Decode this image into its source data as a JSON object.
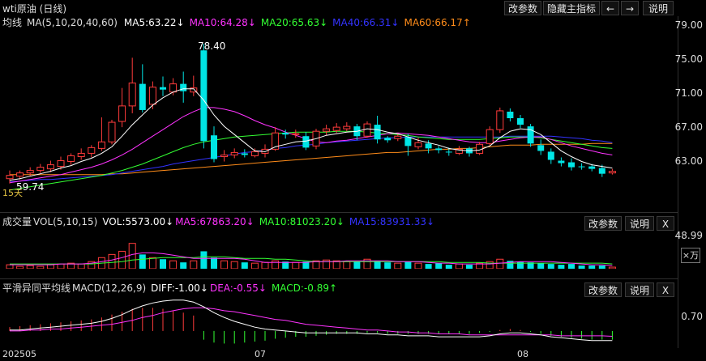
{
  "title": "wti原油 (日线)",
  "toolbar": {
    "params": "改参数",
    "hide_main": "隐藏主指标",
    "left_arrow": "←",
    "right_arrow": "→",
    "help": "说明"
  },
  "ma_panel": {
    "label": "均线",
    "params": "MA(5,10,20,40,60)",
    "ma5": "MA5:63.22↓",
    "ma10": "MA10:64.28↓",
    "ma20": "MA20:65.63↓",
    "ma40": "MA40:66.31↓",
    "ma60": "MA60:66.17↑",
    "high_label": "78.40",
    "low_label": "59.74",
    "corner_label": "15天",
    "axis": [
      "79.00",
      "75.00",
      "71.00",
      "67.00",
      "63.00"
    ]
  },
  "vol_panel": {
    "label": "成交量",
    "params": "VOL(5,10,15)",
    "vol": "VOL:5573.00↓",
    "ma5": "MA5:67863.20↓",
    "ma10": "MA10:81023.20↓",
    "ma15": "MA15:83931.33↓",
    "axis": "48.99",
    "unit": "×万",
    "btn_params": "改参数",
    "btn_help": "说明",
    "btn_close": "X"
  },
  "macd_panel": {
    "label": "平滑异同平均线",
    "params": "MACD(12,26,9)",
    "diff": "DIFF:-1.00↓",
    "dea": "DEA:-0.55↓",
    "macd": "MACD:-0.89↑",
    "axis": "0.70",
    "btn_params": "改参数",
    "btn_help": "说明",
    "btn_close": "X"
  },
  "x_axis": [
    "202505",
    "07",
    "08"
  ],
  "colors": {
    "up": "#ff3b3b",
    "down": "#00e5e5",
    "ma5": "#ffffff",
    "ma10": "#ff33ff",
    "ma20": "#33ff33",
    "ma40": "#3333ff",
    "ma60": "#ff8c1a"
  },
  "chart_data": {
    "type": "candlestick",
    "ylim": [
      59.0,
      80.0
    ],
    "candles": [
      [
        61.9,
        62.3,
        61.3,
        62.9
      ],
      [
        62.2,
        62.6,
        61.8,
        62.9
      ],
      [
        62.6,
        62.9,
        62.2,
        63.3
      ],
      [
        62.9,
        63.3,
        62.6,
        63.7
      ],
      [
        63.1,
        63.6,
        62.7,
        64.1
      ],
      [
        63.4,
        64.1,
        63.0,
        64.6
      ],
      [
        64.0,
        64.7,
        63.6,
        65.0
      ],
      [
        64.6,
        65.0,
        64.2,
        65.6
      ],
      [
        65.0,
        65.7,
        64.5,
        66.0
      ],
      [
        65.6,
        66.4,
        65.3,
        69.4
      ],
      [
        66.4,
        68.8,
        66.1,
        69.1
      ],
      [
        68.9,
        70.8,
        68.2,
        73.0
      ],
      [
        70.8,
        73.6,
        69.9,
        76.7
      ],
      [
        73.5,
        70.3,
        70.0,
        75.9
      ],
      [
        71.0,
        73.1,
        70.4,
        73.8
      ],
      [
        73.1,
        72.8,
        72.0,
        74.4
      ],
      [
        72.5,
        73.5,
        72.1,
        74.2
      ],
      [
        73.5,
        72.6,
        71.2,
        75.0
      ],
      [
        72.5,
        73.0,
        72.0,
        74.5
      ],
      [
        77.6,
        66.5,
        65.6,
        78.4
      ],
      [
        67.2,
        64.3,
        63.9,
        68.3
      ],
      [
        64.6,
        64.8,
        64.0,
        65.4
      ],
      [
        64.8,
        65.1,
        64.4,
        65.6
      ],
      [
        65.0,
        64.8,
        64.5,
        65.5
      ],
      [
        64.7,
        65.2,
        64.5,
        65.6
      ],
      [
        65.0,
        65.5,
        64.5,
        66.1
      ],
      [
        65.5,
        67.5,
        65.3,
        68.2
      ],
      [
        67.5,
        67.3,
        66.8,
        67.9
      ],
      [
        67.3,
        67.4,
        66.9,
        67.9
      ],
      [
        67.1,
        65.7,
        65.4,
        67.6
      ],
      [
        65.9,
        67.7,
        65.5,
        68.0
      ],
      [
        67.7,
        68.0,
        67.2,
        68.5
      ],
      [
        67.8,
        68.2,
        67.5,
        68.7
      ],
      [
        68.0,
        68.3,
        67.7,
        68.8
      ],
      [
        68.3,
        67.1,
        66.6,
        68.6
      ],
      [
        67.1,
        68.6,
        66.9,
        68.9
      ],
      [
        68.5,
        66.7,
        66.2,
        69.6
      ],
      [
        66.9,
        66.6,
        66.3,
        67.1
      ],
      [
        66.8,
        67.1,
        66.5,
        67.5
      ],
      [
        67.0,
        65.9,
        64.7,
        67.4
      ],
      [
        65.8,
        66.3,
        65.5,
        66.9
      ],
      [
        66.2,
        65.6,
        65.0,
        66.6
      ],
      [
        65.6,
        65.4,
        65.0,
        65.9
      ],
      [
        65.2,
        65.1,
        64.7,
        65.7
      ],
      [
        65.0,
        65.5,
        64.8,
        65.9
      ],
      [
        65.6,
        65.0,
        64.6,
        65.8
      ],
      [
        65.0,
        66.1,
        64.8,
        66.4
      ],
      [
        66.2,
        67.9,
        66.0,
        68.3
      ],
      [
        67.9,
        70.2,
        67.5,
        70.6
      ],
      [
        70.1,
        69.3,
        68.9,
        70.5
      ],
      [
        69.3,
        68.5,
        68.1,
        69.7
      ],
      [
        68.3,
        66.2,
        65.8,
        68.6
      ],
      [
        66.0,
        65.3,
        64.8,
        66.7
      ],
      [
        65.2,
        64.2,
        63.7,
        65.6
      ],
      [
        64.1,
        63.8,
        63.4,
        64.5
      ],
      [
        63.9,
        63.3,
        62.9,
        64.4
      ],
      [
        63.4,
        63.3,
        63.0,
        63.8
      ],
      [
        63.4,
        63.1,
        62.8,
        63.7
      ],
      [
        63.2,
        62.5,
        62.1,
        63.6
      ],
      [
        62.6,
        62.8,
        62.4,
        63.1
      ]
    ],
    "ma5": [
      61.7,
      61.9,
      62.2,
      62.5,
      62.8,
      63.2,
      63.5,
      64.0,
      64.4,
      65.0,
      65.8,
      67.1,
      68.5,
      69.7,
      70.9,
      71.8,
      72.5,
      72.9,
      72.9,
      71.5,
      69.7,
      68.3,
      67.3,
      66.3,
      65.3,
      65.2,
      65.8,
      66.1,
      66.4,
      66.5,
      66.8,
      67.2,
      67.4,
      67.6,
      67.7,
      68.0,
      67.9,
      67.6,
      67.4,
      67.0,
      66.6,
      66.3,
      66.0,
      65.6,
      65.4,
      65.3,
      65.4,
      65.9,
      66.9,
      67.7,
      68.0,
      67.9,
      67.3,
      66.3,
      65.3,
      64.6,
      64.0,
      63.6,
      63.4,
      63.2
    ],
    "ma10": [
      61.4,
      61.6,
      61.8,
      62.0,
      62.2,
      62.4,
      62.7,
      63.0,
      63.3,
      63.7,
      64.2,
      64.8,
      65.5,
      66.3,
      67.1,
      67.9,
      68.7,
      69.5,
      70.1,
      70.6,
      70.6,
      70.4,
      70.1,
      69.6,
      69.0,
      68.5,
      68.1,
      67.6,
      67.2,
      66.8,
      66.4,
      66.3,
      66.5,
      66.6,
      66.8,
      67.0,
      67.2,
      67.4,
      67.5,
      67.4,
      67.3,
      67.2,
      67.0,
      66.8,
      66.6,
      66.4,
      66.3,
      66.3,
      66.5,
      66.7,
      66.9,
      67.0,
      67.0,
      66.7,
      66.3,
      65.9,
      65.6,
      65.3,
      65.0,
      64.8
    ],
    "ma20": [
      60.5,
      60.7,
      60.9,
      61.1,
      61.3,
      61.5,
      61.7,
      61.9,
      62.1,
      62.3,
      62.6,
      62.9,
      63.3,
      63.7,
      64.2,
      64.7,
      65.2,
      65.7,
      66.1,
      66.4,
      66.6,
      66.8,
      67.0,
      67.1,
      67.2,
      67.3,
      67.4,
      67.5,
      67.6,
      67.6,
      67.6,
      67.6,
      67.7,
      67.7,
      67.7,
      67.6,
      67.5,
      67.4,
      67.3,
      67.2,
      67.0,
      66.9,
      66.8,
      66.7,
      66.7,
      66.7,
      66.7,
      66.8,
      66.9,
      67.0,
      67.0,
      67.0,
      66.9,
      66.7,
      66.5,
      66.3,
      66.1,
      65.9,
      65.7,
      65.6
    ],
    "ma40": [
      61.5,
      61.6,
      61.7,
      61.8,
      61.8,
      61.9,
      62.0,
      62.1,
      62.2,
      62.3,
      62.4,
      62.6,
      62.8,
      63.0,
      63.2,
      63.4,
      63.7,
      63.9,
      64.1,
      64.3,
      64.5,
      64.7,
      64.9,
      65.1,
      65.2,
      65.4,
      65.6,
      65.7,
      65.9,
      66.0,
      66.1,
      66.3,
      66.4,
      66.5,
      66.6,
      66.7,
      66.8,
      66.9,
      66.9,
      67.0,
      67.0,
      67.0,
      67.0,
      67.0,
      67.0,
      67.0,
      67.0,
      67.0,
      67.0,
      67.1,
      67.1,
      67.1,
      67.1,
      67.1,
      67.0,
      66.9,
      66.8,
      66.6,
      66.5,
      66.3
    ],
    "ma60": [
      62.4,
      62.4,
      62.4,
      62.4,
      62.4,
      62.4,
      62.4,
      62.4,
      62.4,
      62.4,
      62.5,
      62.5,
      62.6,
      62.7,
      62.8,
      62.9,
      63.0,
      63.1,
      63.2,
      63.3,
      63.4,
      63.5,
      63.6,
      63.7,
      63.8,
      63.9,
      64.0,
      64.1,
      64.2,
      64.3,
      64.4,
      64.5,
      64.6,
      64.7,
      64.8,
      64.9,
      65.0,
      65.1,
      65.1,
      65.2,
      65.3,
      65.4,
      65.5,
      65.5,
      65.6,
      65.6,
      65.7,
      65.8,
      65.9,
      66.0,
      66.0,
      66.0,
      66.1,
      66.1,
      66.1,
      66.1,
      66.1,
      66.2,
      66.2,
      66.2
    ],
    "volume": [
      5,
      3,
      4,
      3,
      5,
      6,
      7,
      6,
      9,
      14,
      18,
      22,
      32,
      18,
      14,
      12,
      10,
      8,
      10,
      22,
      14,
      10,
      9,
      8,
      7,
      8,
      10,
      9,
      8,
      9,
      10,
      11,
      10,
      9,
      9,
      12,
      10,
      8,
      7,
      9,
      7,
      6,
      7,
      5,
      6,
      5,
      7,
      9,
      12,
      10,
      9,
      8,
      7,
      6,
      5,
      6,
      4,
      4,
      4,
      2
    ],
    "vol_ylim": [
      0,
      49
    ],
    "vol_ma5": [
      5,
      5,
      5,
      5,
      5,
      6,
      6,
      6,
      7,
      9,
      11,
      14,
      18,
      20,
      20,
      19,
      17,
      15,
      13,
      13,
      13,
      13,
      13,
      12,
      10,
      8,
      8,
      8,
      8,
      8,
      9,
      9,
      9,
      10,
      10,
      10,
      10,
      10,
      9,
      9,
      9,
      8,
      7,
      7,
      6,
      6,
      6,
      6,
      7,
      8,
      9,
      9,
      9,
      9,
      8,
      7,
      6,
      5,
      5,
      4
    ],
    "vol_ma10": [
      6,
      6,
      6,
      6,
      6,
      6,
      6,
      6,
      6,
      7,
      8,
      9,
      11,
      12,
      13,
      14,
      14,
      14,
      14,
      15,
      15,
      15,
      14,
      13,
      13,
      13,
      12,
      12,
      11,
      10,
      9,
      9,
      9,
      9,
      9,
      9,
      9,
      9,
      9,
      9,
      9,
      9,
      9,
      8,
      8,
      8,
      8,
      7,
      7,
      7,
      7,
      7,
      7,
      7,
      7,
      7,
      7,
      7,
      7,
      6
    ],
    "macd_hist": [
      0.4,
      0.5,
      0.6,
      0.7,
      0.8,
      0.9,
      1.0,
      1.1,
      1.2,
      1.4,
      1.7,
      2.0,
      2.3,
      2.4,
      2.4,
      2.3,
      2.1,
      1.9,
      1.6,
      -0.9,
      -1.2,
      -1.3,
      -1.3,
      -1.2,
      -1.1,
      -1.0,
      -0.8,
      -0.7,
      -0.6,
      -0.6,
      -0.5,
      -0.4,
      -0.3,
      -0.3,
      -0.3,
      -0.2,
      -0.2,
      -0.3,
      -0.3,
      -0.3,
      -0.3,
      -0.3,
      -0.3,
      -0.3,
      -0.3,
      -0.3,
      -0.2,
      -0.1,
      0.1,
      0.2,
      0.1,
      -0.1,
      -0.3,
      -0.5,
      -0.6,
      -0.7,
      -0.8,
      -0.9,
      -0.9,
      -0.9
    ],
    "macd_diff": [
      0.1,
      0.1,
      0.2,
      0.3,
      0.4,
      0.5,
      0.6,
      0.7,
      0.8,
      1.0,
      1.3,
      1.7,
      2.2,
      2.6,
      2.9,
      3.1,
      3.2,
      3.2,
      3.0,
      2.5,
      1.9,
      1.4,
      1.0,
      0.7,
      0.4,
      0.2,
      0.1,
      0.0,
      -0.1,
      -0.2,
      -0.2,
      -0.2,
      -0.2,
      -0.2,
      -0.2,
      -0.3,
      -0.3,
      -0.4,
      -0.4,
      -0.5,
      -0.5,
      -0.5,
      -0.6,
      -0.6,
      -0.6,
      -0.6,
      -0.6,
      -0.5,
      -0.3,
      -0.2,
      -0.2,
      -0.3,
      -0.4,
      -0.6,
      -0.7,
      -0.8,
      -0.9,
      -1.0,
      -1.0,
      -1.0
    ],
    "macd_dea": [
      0.0,
      0.0,
      0.1,
      0.1,
      0.2,
      0.2,
      0.3,
      0.4,
      0.5,
      0.6,
      0.7,
      0.9,
      1.1,
      1.4,
      1.6,
      1.9,
      2.1,
      2.3,
      2.4,
      2.4,
      2.3,
      2.1,
      2.0,
      1.8,
      1.6,
      1.4,
      1.2,
      1.1,
      0.9,
      0.7,
      0.6,
      0.5,
      0.4,
      0.3,
      0.2,
      0.1,
      0.1,
      0.0,
      -0.1,
      -0.1,
      -0.2,
      -0.2,
      -0.3,
      -0.3,
      -0.3,
      -0.4,
      -0.4,
      -0.4,
      -0.4,
      -0.4,
      -0.4,
      -0.4,
      -0.4,
      -0.4,
      -0.5,
      -0.5,
      -0.5,
      -0.5,
      -0.5,
      -0.55
    ],
    "macd_ylim": [
      -1.6,
      3.6
    ]
  }
}
